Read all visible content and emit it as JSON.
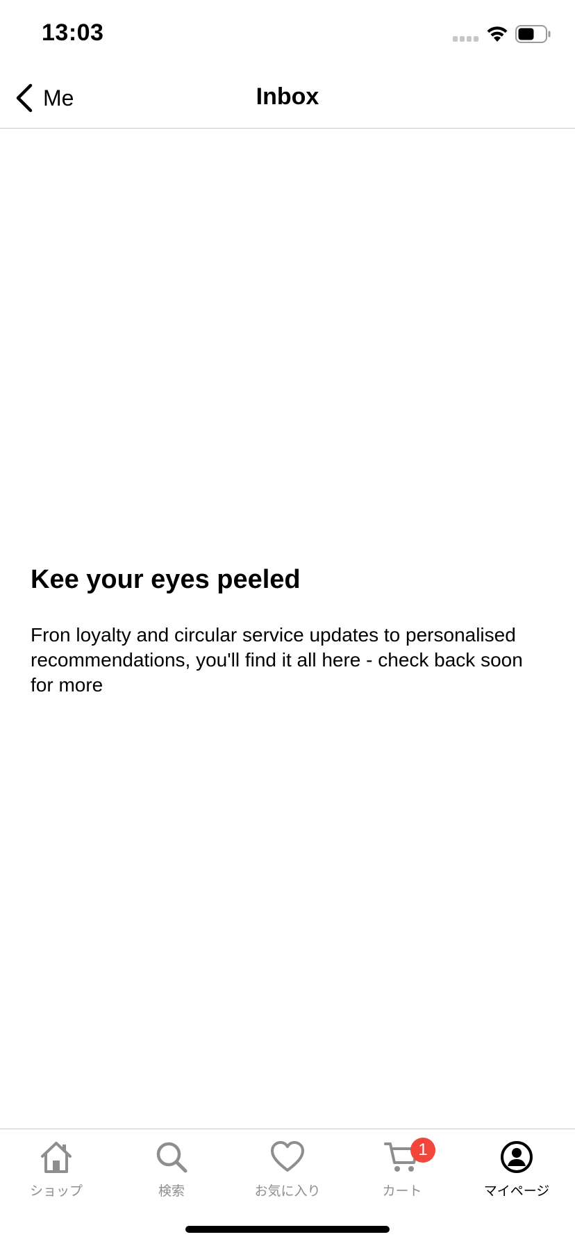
{
  "status_bar": {
    "time": "13:03"
  },
  "nav": {
    "back_label": "Me",
    "title": "Inbox"
  },
  "empty_state": {
    "title": "Kee your eyes peeled",
    "body": "Fron loyalty and circular service updates to personalised recommendations, you'll find it all here - check back soon for more"
  },
  "tabs": [
    {
      "label": "ショップ",
      "icon": "home-icon",
      "active": false
    },
    {
      "label": "検索",
      "icon": "search-icon",
      "active": false
    },
    {
      "label": "お気に入り",
      "icon": "heart-icon",
      "active": false
    },
    {
      "label": "カート",
      "icon": "cart-icon",
      "active": false,
      "badge": "1"
    },
    {
      "label": "マイページ",
      "icon": "profile-icon",
      "active": true
    }
  ],
  "colors": {
    "badge": "#f2453b",
    "inactive_tab": "#8e8e8e",
    "active_tab": "#000000",
    "divider": "#c8c8c8"
  }
}
